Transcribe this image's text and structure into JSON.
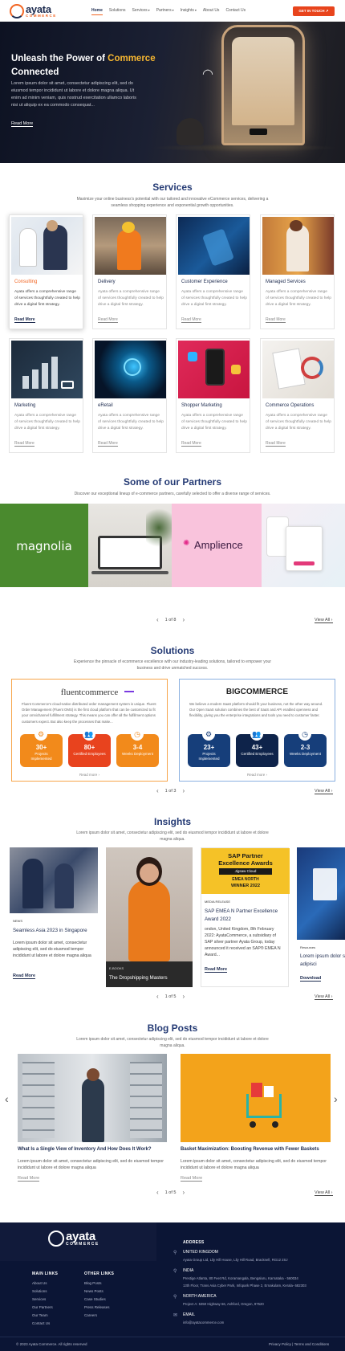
{
  "header": {
    "logo_name": "ayata",
    "logo_sub": "COMMERCE",
    "nav": [
      {
        "label": "Home",
        "active": true,
        "caret": ""
      },
      {
        "label": "Solutions",
        "active": false,
        "caret": ""
      },
      {
        "label": "Services",
        "active": false,
        "caret": "▾"
      },
      {
        "label": "Partners",
        "active": false,
        "caret": "▾"
      },
      {
        "label": "Insights",
        "active": false,
        "caret": "▾"
      },
      {
        "label": "About Us",
        "active": false,
        "caret": ""
      },
      {
        "label": "Contact Us",
        "active": false,
        "caret": ""
      }
    ],
    "cta_label": "GET IN TOUCH ↗"
  },
  "hero": {
    "title_part1": "Unleash the Power of ",
    "title_accent": "Commerce",
    "title_part2": "Connected",
    "description": "Lorem ipsum dolor sit amet, consectetur adipiscing elit, sed do eiusmod tempor incididunt ut labore et dolore magna aliqua. Ut enim ad minim veniam, quis nostrud exercitation ullamco laboris nisi ut aliquip ex ea commodo consequat...",
    "link": "Read More"
  },
  "services": {
    "title": "Services",
    "subtitle": "Maximize your online business's potential with our tailored and innovative eCommerce services, delivering a seamless shopping experience and exponential growth opportunities.",
    "items": [
      {
        "name": "Consulting",
        "desc": "Ayata offers a comprehensive range of services thoughtfully created to help drive a digital first strategy.",
        "link": "Read More"
      },
      {
        "name": "Delivery",
        "desc": "Ayata offers a comprehensive range of services thoughtfully created to help drive a digital first strategy.",
        "link": "Read More"
      },
      {
        "name": "Customer Experience",
        "desc": "Ayata offers a comprehensive range of services thoughtfully created to help drive a digital first strategy.",
        "link": "Read More"
      },
      {
        "name": "Managed Services",
        "desc": "Ayata offers a comprehensive range of services thoughtfully created to help drive a digital first strategy.",
        "link": "Read More"
      },
      {
        "name": "Marketing",
        "desc": "Ayata offers a comprehensive range of services thoughtfully created to help drive a digital first strategy.",
        "link": "Read More"
      },
      {
        "name": "eRetail",
        "desc": "Ayata offers a comprehensive range of services thoughtfully created to help drive a digital first strategy.",
        "link": "Read More"
      },
      {
        "name": "Shopper Marketing",
        "desc": "Ayata offers a comprehensive range of services thoughtfully created to help drive a digital first strategy.",
        "link": "Read More"
      },
      {
        "name": "Commerce Operations",
        "desc": "Ayata offers a comprehensive range of services thoughtfully created to help drive a digital first strategy.",
        "link": "Read More"
      }
    ]
  },
  "partners": {
    "title": "Some of our Partners",
    "subtitle": "Discover our exceptional lineup of e-commerce partners, carefully selected to offer a diverse range of services.",
    "logos": [
      "magnolia",
      "Amplience"
    ],
    "pager": "1 of 8",
    "view_all": "View All ›"
  },
  "solutions": {
    "title": "Solutions",
    "subtitle": "Experience the pinnacle of ecommerce excellence with our industry-leading solutions, tailored to empower your business and drive unmatched success.",
    "cards": [
      {
        "logo": "fluentcommerce",
        "desc": "Fluent Commerce's cloud-native distributed order management system is unique. Fluent Order Management (Fluent OMS) is the first cloud platform that can be customized to fit your omnichannel fulfillment strategy. This means you can offer all the fulfillment options customers expect. But also keep the processes that make...",
        "stats": [
          {
            "value": "30+",
            "label": "Projects Implemented",
            "icon": "⚙"
          },
          {
            "value": "80+",
            "label": "Certified Employees",
            "icon": "👥"
          },
          {
            "value": "3-4",
            "label": "Weeks Deployment",
            "icon": "◷"
          }
        ],
        "more": "Read more ›"
      },
      {
        "logo": "BIGCOMMERCE",
        "desc": "We believe a modern SaaS platform should fit your business, not the other way around. Our Open SaaS solution combines the best of SaaS and API enabled openness and flexibility, giving you the enterprise integrations and tools you need to customer faster.",
        "stats": [
          {
            "value": "23+",
            "label": "Projects Implemented",
            "icon": "⚙"
          },
          {
            "value": "43+",
            "label": "Certified Employees",
            "icon": "👥"
          },
          {
            "value": "2-3",
            "label": "Weeks Deployment",
            "icon": "◷"
          }
        ],
        "more": "Read more ›"
      }
    ],
    "pager": "1 of 3",
    "view_all": "View All ›"
  },
  "insights": {
    "title": "Insights",
    "subtitle": "Lorem ipsum dolor sit amet, consectetur adipiscing elit, sed do eiusmod tempor incididunt ut labore et dolore magna aliqua.",
    "cards": [
      {
        "tag": "NEWS",
        "title": "Seamless Asia 2023 in Singapore",
        "desc": "Lorem ipsum dolor sit amet, consectetur adipiscing elit, sed do eiusmod tempor incididunt ut labore et dolore magna aliqua",
        "link": "Read More"
      },
      {
        "tag": "E-BOOKS",
        "title": "The Dropshipping Masters"
      },
      {
        "tag": "MEDIA RELEASE",
        "title": "SAP EMEA N Partner Excellence Award 2022",
        "desc": "ondon, United Kingdom, 8th February 2022: AyataCommerce, a subsidiary of SAP silver partner Ayata Group, today announced it received an SAP® EMEA N Award...",
        "link": "Read More",
        "badge_line1": "SAP Partner",
        "badge_line2": "Excellence Awards",
        "badge_line3": "Jigsaw Cloud",
        "badge_line4": "EMEA NORTH",
        "badge_line5": "WINNER 2022"
      },
      {
        "tag": "Resources",
        "title": "Lorem ipsum dolor s consectetur adipisci",
        "link": "Download"
      }
    ],
    "pager": "1 of 5",
    "view_all": "View All ›"
  },
  "blog": {
    "title": "Blog Posts",
    "subtitle": "Lorem ipsum dolor sit amet, consectetur adipiscing elit, sed do eiusmod tempor incididunt ut labore et dolore magna aliqua.",
    "posts": [
      {
        "title": "What Is a Single View of Inventory And How Does It Work?",
        "desc": "Lorem ipsum dolor sit amet, consectetur adipiscing elit, sed do eiusmod tempor incididunt ut labore et dolore magna aliqua",
        "link": "Read More"
      },
      {
        "title": "Basket Maximization: Boosting Revenue with Fewer Baskets",
        "desc": "Lorem ipsum dolor sit amet, consectetur adipiscing elit, sed do eiusmod tempor incididunt ut labore et dolore magna aliqua",
        "link": "Read More"
      }
    ],
    "pager": "1 of 5",
    "view_all": "View All ›"
  },
  "footer": {
    "logo_name": "ayata",
    "logo_sub": "COMMERCE",
    "main_links_head": "MAIN LINKS",
    "main_links": [
      "About Us",
      "Solutions",
      "Services",
      "Our Partners",
      "Our Team",
      "Contact Us"
    ],
    "other_links_head": "OTHER LINKS",
    "other_links": [
      "Blog Posts",
      "News Posts",
      "Case Studies",
      "Press Releases",
      "Careers"
    ],
    "address_head": "ADDRESS",
    "addresses": [
      {
        "region": "UNITED KINGDOM",
        "lines": [
          "Ayata Group Ltd, Lily Hill House, Lily Hill Road, Bracknell, RG12 2SJ"
        ]
      },
      {
        "region": "INDIA",
        "lines": [
          "Prestige Atlanta, 80 Feet Rd, Koramangala, Bengaluru, Karnataka - 560034",
          "13th Floor, Trans Asia Cyber Park, Infopark Phase 2, Ernakulam, Kerala- 682303"
        ]
      },
      {
        "region": "NORTH AMERICA",
        "lines": [
          "Project A: 5350 Highway 66, Ashford, Oregon, 97520"
        ]
      },
      {
        "region": "EMAIL",
        "lines": [
          "info@ayatacommerce.com"
        ]
      }
    ],
    "copyright": "© 2023 Ayata Commerce. All rights reserved",
    "legal": "Privacy Policy  |  Terms and Conditions"
  }
}
